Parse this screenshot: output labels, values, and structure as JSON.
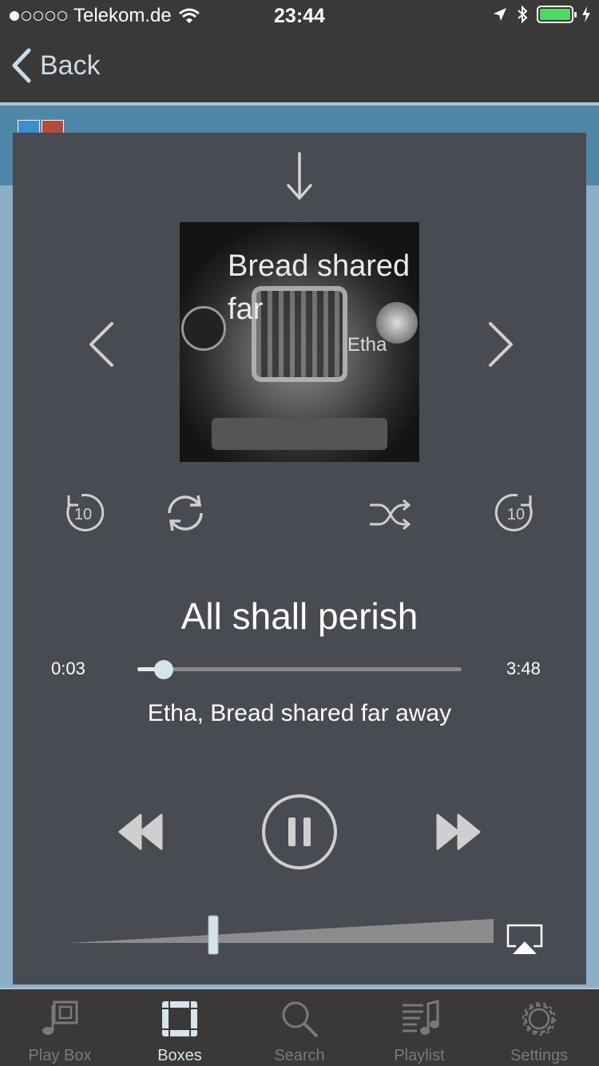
{
  "status_bar": {
    "carrier": "Telekom.de",
    "time": "23:44",
    "signal_dots_filled": 1,
    "signal_dots_total": 5
  },
  "nav": {
    "back_label": "Back"
  },
  "player": {
    "cover": {
      "title_text": "Bread shared far",
      "artist_text": "Etha"
    },
    "skip_back_seconds": "10",
    "skip_forward_seconds": "10",
    "track_title": "All shall perish",
    "elapsed": "0:03",
    "total": "3:48",
    "progress_fraction": 0.013,
    "artist_album": "Etha, Bread shared far away",
    "volume_fraction": 0.34,
    "state": "playing"
  },
  "tabs": [
    {
      "label": "Play Box",
      "icon": "play-box-icon",
      "active": false
    },
    {
      "label": "Boxes",
      "icon": "boxes-icon",
      "active": true
    },
    {
      "label": "Search",
      "icon": "search-icon",
      "active": false
    },
    {
      "label": "Playlist",
      "icon": "playlist-icon",
      "active": false
    },
    {
      "label": "Settings",
      "icon": "gear-icon",
      "active": false
    }
  ],
  "colors": {
    "chrome": "#3b3838",
    "player_bg": "#484b52",
    "accent_blue": "#4f87a8",
    "active_tab": "#d7e4ec",
    "battery": "#4cd964"
  }
}
